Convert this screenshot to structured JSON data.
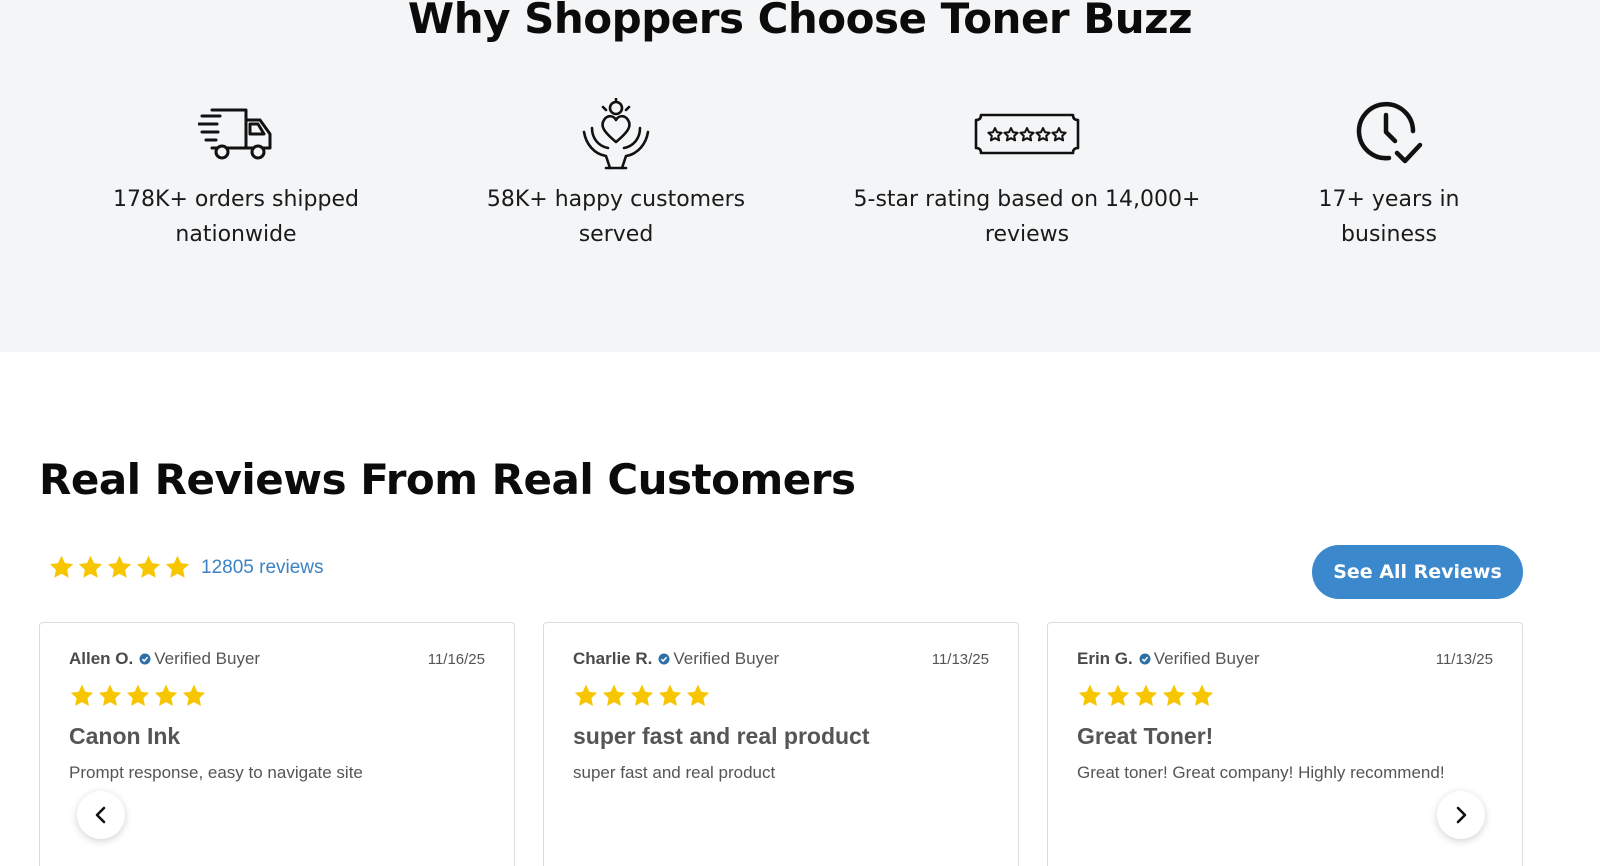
{
  "why": {
    "title": "Why Shoppers Choose Toner Buzz",
    "features": [
      {
        "icon": "delivery-truck-icon",
        "line1": "178K+ orders shipped",
        "line2": "nationwide"
      },
      {
        "icon": "heart-hands-icon",
        "line1": "58K+ happy customers",
        "line2": "served"
      },
      {
        "icon": "star-rating-badge-icon",
        "line1": "5-star rating based on 14,000+",
        "line2": "reviews"
      },
      {
        "icon": "clock-check-icon",
        "line1": "17+ years in",
        "line2": "business"
      }
    ]
  },
  "reviews": {
    "title": "Real Reviews From Real Customers",
    "summary": {
      "rating": 5,
      "count_text": "12805 reviews"
    },
    "see_all_label": "See All Reviews",
    "cards": [
      {
        "name": "Allen O.",
        "badge": "Verified Buyer",
        "date": "11/16/25",
        "rating": 5,
        "title": "Canon Ink",
        "body": "Prompt response, easy to navigate site"
      },
      {
        "name": "Charlie R.",
        "badge": "Verified Buyer",
        "date": "11/13/25",
        "rating": 5,
        "title": "super fast and real product",
        "body": "super fast and real product"
      },
      {
        "name": "Erin G.",
        "badge": "Verified Buyer",
        "date": "11/13/25",
        "rating": 5,
        "title": "Great Toner!",
        "body": "Great toner! Great company! Highly recommend!"
      }
    ]
  },
  "colors": {
    "star": "#f7c600",
    "accent": "#3b88cc",
    "section_bg": "#f4f5f6",
    "link": "#3b82c4"
  },
  "icons": {
    "prev": "chevron-left-icon",
    "next": "chevron-right-icon",
    "verified": "verified-check-icon",
    "star": "star-icon"
  }
}
